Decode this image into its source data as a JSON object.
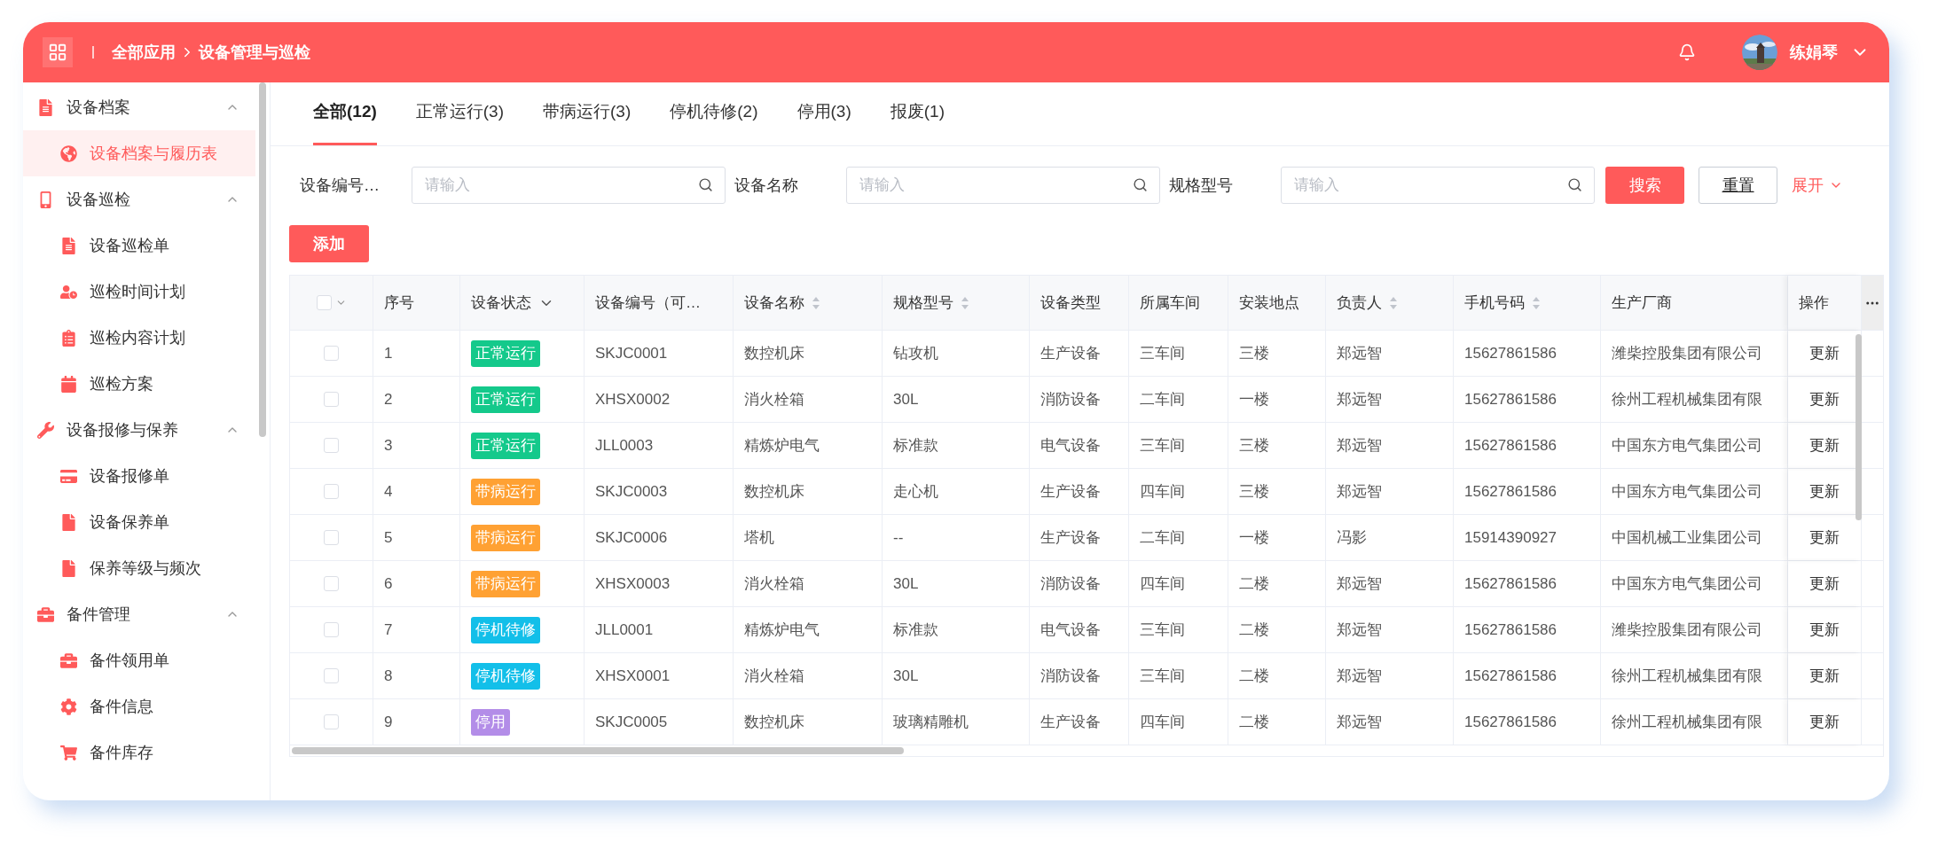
{
  "header": {
    "breadcrumb": [
      "全部应用",
      "设备管理与巡检"
    ],
    "user": {
      "name": "练娟琴"
    }
  },
  "sidebar": {
    "groups": [
      {
        "label": "设备档案",
        "expanded": true,
        "children": [
          {
            "label": "设备档案与履历表",
            "selected": true
          }
        ]
      },
      {
        "label": "设备巡检",
        "expanded": true,
        "children": [
          {
            "label": "设备巡检单",
            "selected": false
          },
          {
            "label": "巡检时间计划",
            "selected": false
          },
          {
            "label": "巡检内容计划",
            "selected": false
          },
          {
            "label": "巡检方案",
            "selected": false
          }
        ]
      },
      {
        "label": "设备报修与保养",
        "expanded": true,
        "children": [
          {
            "label": "设备报修单",
            "selected": false
          },
          {
            "label": "设备保养单",
            "selected": false
          },
          {
            "label": "保养等级与频次",
            "selected": false
          }
        ]
      },
      {
        "label": "备件管理",
        "expanded": true,
        "children": [
          {
            "label": "备件领用单",
            "selected": false
          },
          {
            "label": "备件信息",
            "selected": false
          },
          {
            "label": "备件库存",
            "selected": false
          }
        ]
      }
    ]
  },
  "tabs": [
    {
      "label": "全部(12)",
      "selected": true
    },
    {
      "label": "正常运行(3)",
      "selected": false
    },
    {
      "label": "带病运行(3)",
      "selected": false
    },
    {
      "label": "停机待修(2)",
      "selected": false
    },
    {
      "label": "停用(3)",
      "selected": false
    },
    {
      "label": "报废(1)",
      "selected": false
    }
  ],
  "filters": [
    {
      "label": "设备编号…",
      "placeholder": "请输入"
    },
    {
      "label": "设备名称",
      "placeholder": "请输入"
    },
    {
      "label": "规格型号",
      "placeholder": "请输入"
    }
  ],
  "buttons": {
    "search": "搜索",
    "reset": "重置",
    "expand": "展开"
  },
  "add_button": "添加",
  "table": {
    "select_all": {
      "checked": false
    },
    "columns": [
      {
        "label": "序号",
        "kind": "plain"
      },
      {
        "label": "设备状态",
        "kind": "filter"
      },
      {
        "label": "设备编号（可…",
        "kind": "plain"
      },
      {
        "label": "设备名称",
        "kind": "sortable"
      },
      {
        "label": "规格型号",
        "kind": "sortable"
      },
      {
        "label": "设备类型",
        "kind": "plain"
      },
      {
        "label": "所属车间",
        "kind": "plain"
      },
      {
        "label": "安装地点",
        "kind": "plain"
      },
      {
        "label": "负责人",
        "kind": "sortable"
      },
      {
        "label": "手机号码",
        "kind": "sortable"
      },
      {
        "label": "生产厂商",
        "kind": "plain"
      },
      {
        "label": "操作",
        "kind": "plain"
      }
    ],
    "rows": [
      {
        "checked": false,
        "color": "#14c98b",
        "cells": [
          "1",
          "正常运行",
          "SKJC0001",
          "数控机床",
          "钻攻机",
          "生产设备",
          "三车间",
          "三楼",
          "郑远智",
          "15627861586",
          "潍柴控股集团有限公司",
          "更新"
        ]
      },
      {
        "checked": false,
        "color": "#14c98b",
        "cells": [
          "2",
          "正常运行",
          "XHSX0002",
          "消火栓箱",
          "30L",
          "消防设备",
          "二车间",
          "一楼",
          "郑远智",
          "15627861586",
          "徐州工程机械集团有限",
          "更新"
        ]
      },
      {
        "checked": false,
        "color": "#14c98b",
        "cells": [
          "3",
          "正常运行",
          "JLL0003",
          "精炼炉电气",
          "标准款",
          "电气设备",
          "三车间",
          "三楼",
          "郑远智",
          "15627861586",
          "中国东方电气集团公司",
          "更新"
        ]
      },
      {
        "checked": false,
        "color": "#ffa133",
        "cells": [
          "4",
          "带病运行",
          "SKJC0003",
          "数控机床",
          "走心机",
          "生产设备",
          "四车间",
          "三楼",
          "郑远智",
          "15627861586",
          "中国东方电气集团公司",
          "更新"
        ]
      },
      {
        "checked": false,
        "color": "#ffa133",
        "cells": [
          "5",
          "带病运行",
          "SKJC0006",
          "塔机",
          "--",
          "生产设备",
          "二车间",
          "一楼",
          "冯影",
          "15914390927",
          "中国机械工业集团公司",
          "更新"
        ]
      },
      {
        "checked": false,
        "color": "#ffa133",
        "cells": [
          "6",
          "带病运行",
          "XHSX0003",
          "消火栓箱",
          "30L",
          "消防设备",
          "四车间",
          "二楼",
          "郑远智",
          "15627861586",
          "中国东方电气集团公司",
          "更新"
        ]
      },
      {
        "checked": false,
        "color": "#12bfe9",
        "cells": [
          "7",
          "停机待修",
          "JLL0001",
          "精炼炉电气",
          "标准款",
          "电气设备",
          "三车间",
          "二楼",
          "郑远智",
          "15627861586",
          "潍柴控股集团有限公司",
          "更新"
        ]
      },
      {
        "checked": false,
        "color": "#12bfe9",
        "cells": [
          "8",
          "停机待修",
          "XHSX0001",
          "消火栓箱",
          "30L",
          "消防设备",
          "三车间",
          "二楼",
          "郑远智",
          "15627861586",
          "徐州工程机械集团有限",
          "更新"
        ]
      },
      {
        "checked": false,
        "color": "#b38de8",
        "cells": [
          "9",
          "停用",
          "SKJC0005",
          "数控机床",
          "玻璃精雕机",
          "生产设备",
          "四车间",
          "二楼",
          "郑远智",
          "15627861586",
          "徐州工程机械集团有限",
          "更新"
        ]
      }
    ]
  }
}
